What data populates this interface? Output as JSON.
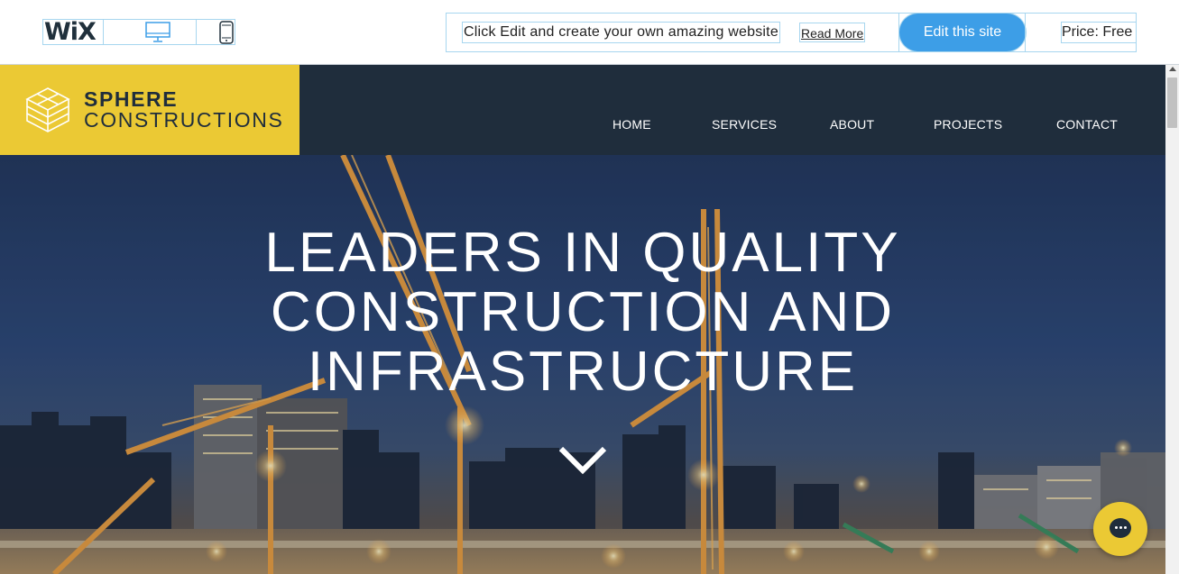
{
  "wix_bar": {
    "logo": "WiX",
    "promo_text": "Click Edit and create your own amazing website",
    "read_more": "Read More",
    "edit_button": "Edit this site",
    "price": "Price: Free",
    "icons": [
      "desktop-icon",
      "mobile-icon"
    ]
  },
  "site": {
    "brand_line1": "SPHERE",
    "brand_line2": "CONSTRUCTIONS",
    "nav": [
      "HOME",
      "SERVICES",
      "ABOUT",
      "PROJECTS",
      "CONTACT"
    ],
    "hero_title": [
      "LEADERS IN QUALITY",
      "CONSTRUCTION AND",
      "INFRASTRUCTURE"
    ],
    "icons": [
      "brand-logo-icon",
      "chevron-down-icon",
      "chat-icon"
    ]
  },
  "colors": {
    "brand_yellow": "#ebc934",
    "header_navy": "#1f2d3c",
    "edit_button_blue": "#3d9ee7",
    "frame_outline": "#a7d6ef"
  }
}
